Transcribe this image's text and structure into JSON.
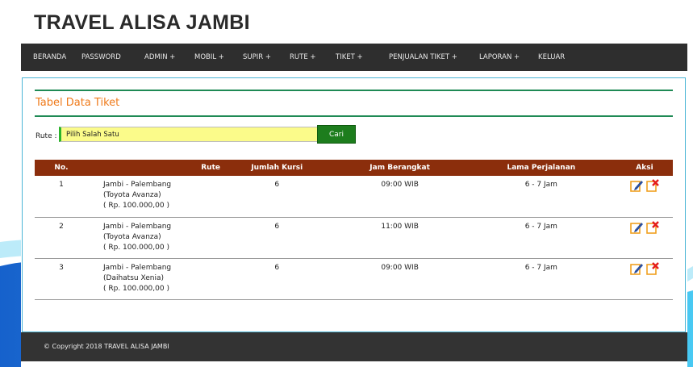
{
  "site": {
    "title": "TRAVEL ALISA JAMBI"
  },
  "nav": {
    "items": [
      "BERANDA",
      "PASSWORD",
      "ADMIN +",
      "MOBIL +",
      "SUPIR +",
      "RUTE +",
      "TIKET +",
      "PENJUALAN TIKET +",
      "LAPORAN +",
      "KELUAR"
    ]
  },
  "panel": {
    "title": "Tabel Data Tiket"
  },
  "filter": {
    "label": "Rute :",
    "selected": "Pilih Salah Satu",
    "button": "Cari"
  },
  "table": {
    "headers": [
      "No.",
      "Rute",
      "Jumlah Kursi",
      "Jam Berangkat",
      "Lama Perjalanan",
      "Aksi"
    ],
    "rows": [
      {
        "no": "1",
        "route": "Jambi - Palembang",
        "car": "(Toyota Avanza)",
        "price": "( Rp. 100.000,00 )",
        "seats": "6",
        "depart": "09:00 WIB",
        "duration": "6 - 7 Jam"
      },
      {
        "no": "2",
        "route": "Jambi - Palembang",
        "car": "(Toyota Avanza)",
        "price": "( Rp. 100.000,00 )",
        "seats": "6",
        "depart": "11:00 WIB",
        "duration": "6 - 7 Jam"
      },
      {
        "no": "3",
        "route": "Jambi - Palembang",
        "car": "(Daihatsu Xenia)",
        "price": "( Rp. 100.000,00 )",
        "seats": "6",
        "depart": "09:00 WIB",
        "duration": "6 - 7 Jam"
      }
    ]
  },
  "icons": {
    "edit": "edit-icon",
    "delete": "delete-icon"
  },
  "colors": {
    "nav_bg": "#2e2e2e",
    "title_accent": "#ef7a1a",
    "table_header": "#8b2e0c",
    "button_green": "#1d7d1d",
    "select_bg": "#fbfb8a"
  },
  "footer": {
    "text": "© Copyright 2018 TRAVEL ALISA JAMBI"
  }
}
